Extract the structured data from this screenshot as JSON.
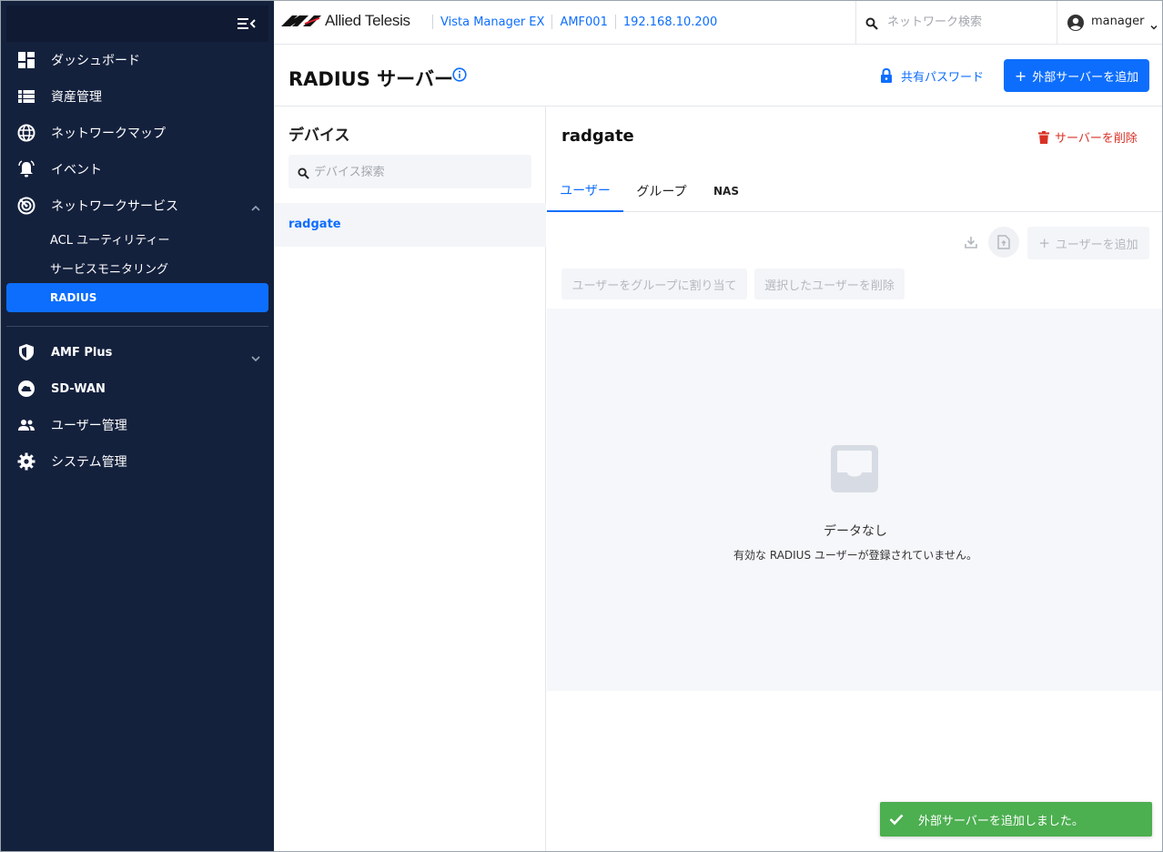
{
  "app": {
    "brand": "Allied Telesis",
    "breadcrumbs": [
      "Vista Manager EX",
      "AMF001",
      "192.168.10.200"
    ],
    "search_placeholder": "ネットワーク検索",
    "user": "manager"
  },
  "sidebar": {
    "items": [
      {
        "label": "ダッシュボード",
        "icon": "dashboard-icon"
      },
      {
        "label": "資産管理",
        "icon": "list-icon"
      },
      {
        "label": "ネットワークマップ",
        "icon": "globe-icon"
      },
      {
        "label": "イベント",
        "icon": "bell-icon"
      },
      {
        "label": "ネットワークサービス",
        "icon": "radar-icon"
      }
    ],
    "sub_items": [
      {
        "label": "ACL ユーティリティー"
      },
      {
        "label": "サービスモニタリング"
      },
      {
        "label": "RADIUS"
      }
    ],
    "bottom_items": [
      {
        "label": "AMF Plus",
        "icon": "shield-icon"
      },
      {
        "label": "SD-WAN",
        "icon": "cloud-icon"
      },
      {
        "label": "ユーザー管理",
        "icon": "people-icon"
      },
      {
        "label": "システム管理",
        "icon": "gear-icon"
      }
    ]
  },
  "page": {
    "title": "RADIUS サーバー",
    "shared_password": "共有パスワード",
    "add_external_server": "外部サーバーを追加"
  },
  "devices": {
    "title": "デバイス",
    "search_placeholder": "デバイス探索",
    "items": [
      "radgate"
    ]
  },
  "detail": {
    "title": "radgate",
    "delete_server": "サーバーを削除",
    "tabs": [
      "ユーザー",
      "グループ",
      "NAS"
    ],
    "add_user": "ユーザーを追加",
    "assign_group": "ユーザーをグループに割り当て",
    "delete_selected": "選択したユーザーを削除",
    "empty_title": "データなし",
    "empty_subtitle": "有効な RADIUS ユーザーが登録されていません。"
  },
  "toast": {
    "message": "外部サーバーを追加しました。"
  },
  "colors": {
    "sidebar_bg": "#14213d",
    "accent": "#0d6efd",
    "danger": "#d93025",
    "success": "#4caf50"
  }
}
